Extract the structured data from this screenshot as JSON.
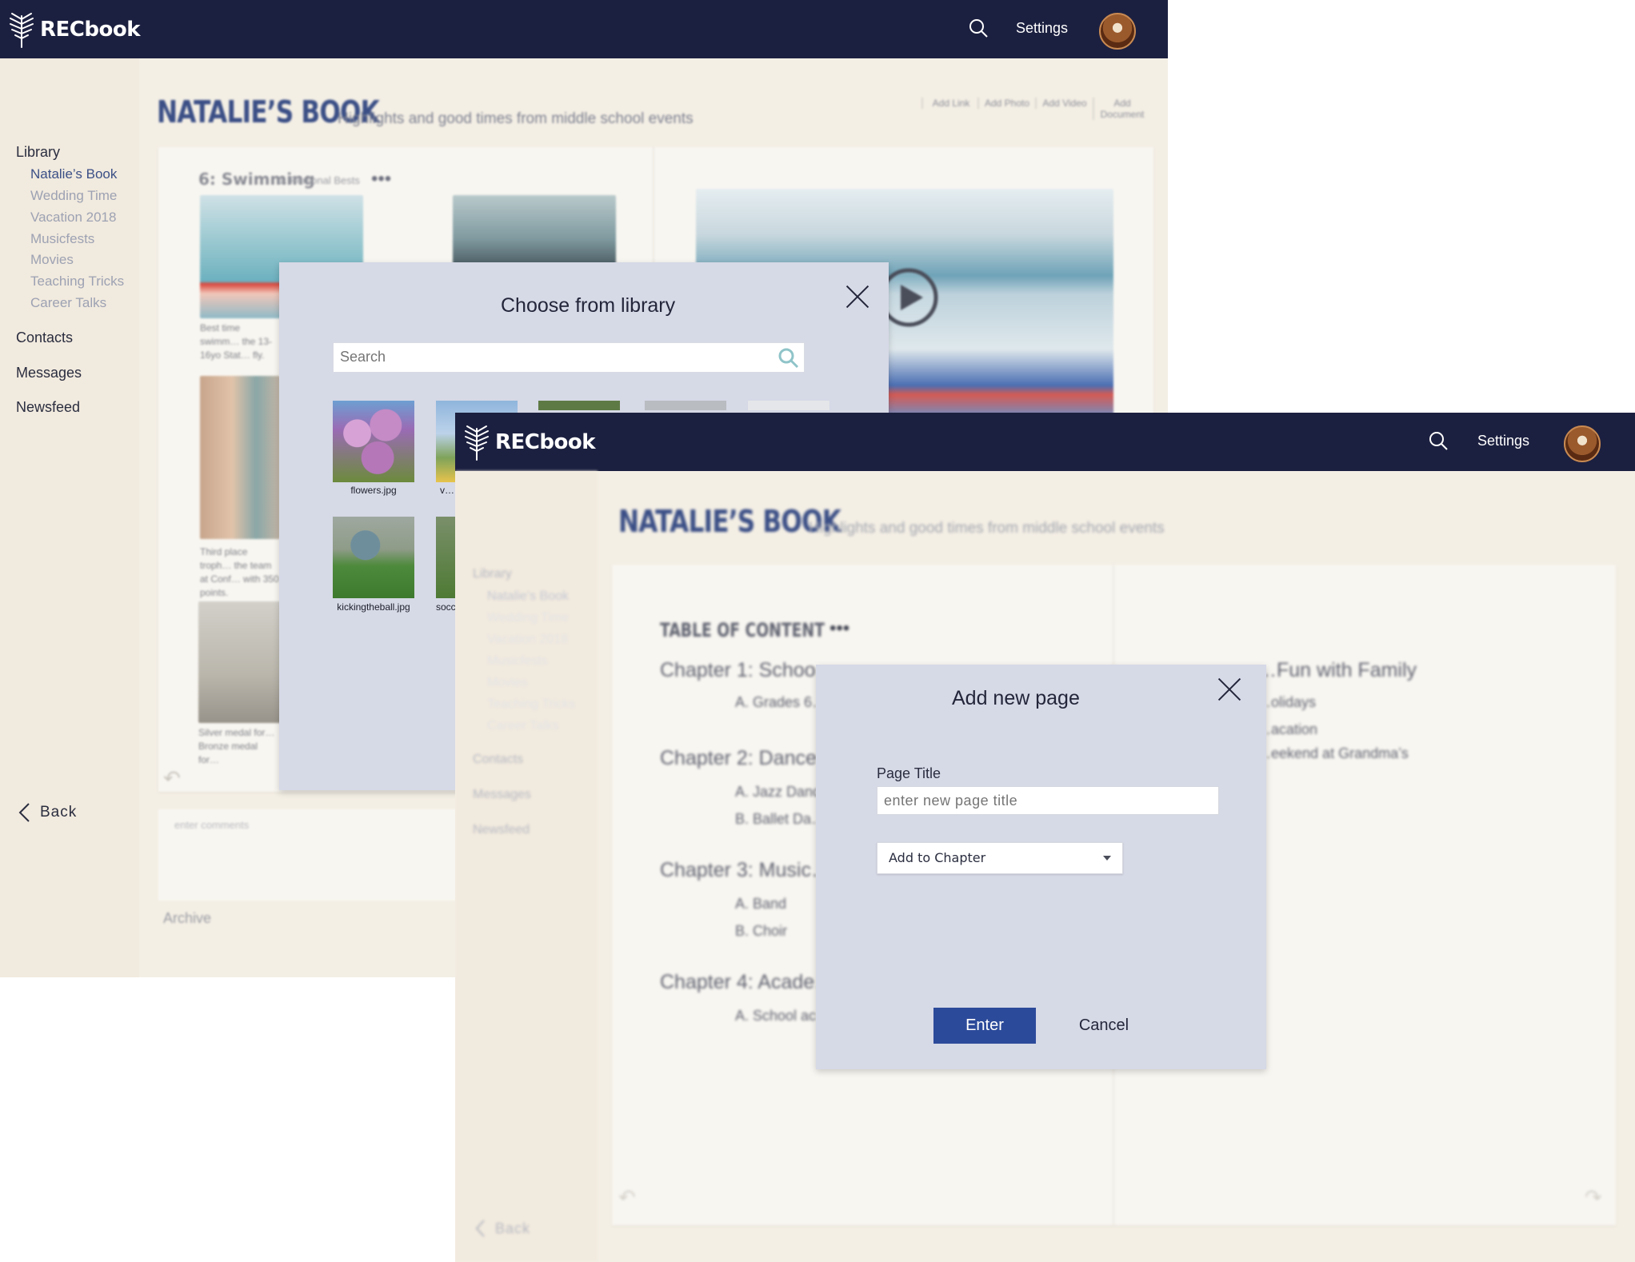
{
  "app": {
    "name": "RECbook"
  },
  "nav": {
    "settings_label": "Settings"
  },
  "sidebar": {
    "library_label": "Library",
    "library_items": [
      "Natalie’s Book",
      "Wedding Time",
      "Vacation 2018",
      "Musicfests",
      "Movies",
      "Teaching Tricks",
      "Career Talks"
    ],
    "contacts_label": "Contacts",
    "messages_label": "Messages",
    "newsfeed_label": "Newsfeed",
    "back_label": "Back"
  },
  "book": {
    "title": "NATALIE’S BOOK",
    "subtitle": "Highlights and good times from middle school events",
    "toolbar": {
      "add_link": "Add Link",
      "add_photo": "Add Photo",
      "add_video": "Add Video",
      "add_document": "Add Document"
    }
  },
  "screen1": {
    "page_heading": "6: Swimming",
    "page_subheading": "1. Personal Bests",
    "captions": [
      "Best time swimm… the 13-16yo Stat… fly.",
      "Third place troph… the team at Conf… with 350 points.",
      "Silver medal for… Bronze medal for…"
    ],
    "comment_placeholder": "enter comments",
    "archive_label": "Archive"
  },
  "library_modal": {
    "title": "Choose from library",
    "search_placeholder": "Search",
    "thumbnails": [
      {
        "filename": "flowers.jpg"
      },
      {
        "filename": "v…"
      },
      {
        "filename": ""
      },
      {
        "filename": ""
      },
      {
        "filename": ""
      },
      {
        "filename": "kickingtheball.jpg"
      },
      {
        "filename": "socc…"
      }
    ]
  },
  "screen2": {
    "toc_heading": "TABLE OF CONTENT",
    "chapters": [
      {
        "title": "Chapter 1: Schoo…",
        "sections": [
          "A. Grades 6…"
        ]
      },
      {
        "title": "Chapter 2: Dance…",
        "sections": [
          "A. Jazz Danc…",
          "B. Ballet Da…"
        ]
      },
      {
        "title": "Chapter 3: Music…",
        "sections": [
          "A. Band",
          "B. Choir"
        ]
      },
      {
        "title": "Chapter 4: Acade…",
        "sections": [
          "A. School ac…"
        ]
      }
    ],
    "right_chapter": {
      "title": "…Fun with Family",
      "sections": [
        "…olidays",
        "…acation",
        "…eekend at Grandma’s"
      ]
    }
  },
  "add_page_modal": {
    "title": "Add new page",
    "page_title_label": "Page Title",
    "page_title_placeholder": "enter new page title",
    "chapter_select_value": "Add to Chapter",
    "enter_label": "Enter",
    "cancel_label": "Cancel"
  },
  "colors": {
    "navbar": "#1c2040",
    "accent": "#2c4a9a",
    "modal_bg": "#d6d9e6",
    "page_bg": "#f4efe5"
  }
}
